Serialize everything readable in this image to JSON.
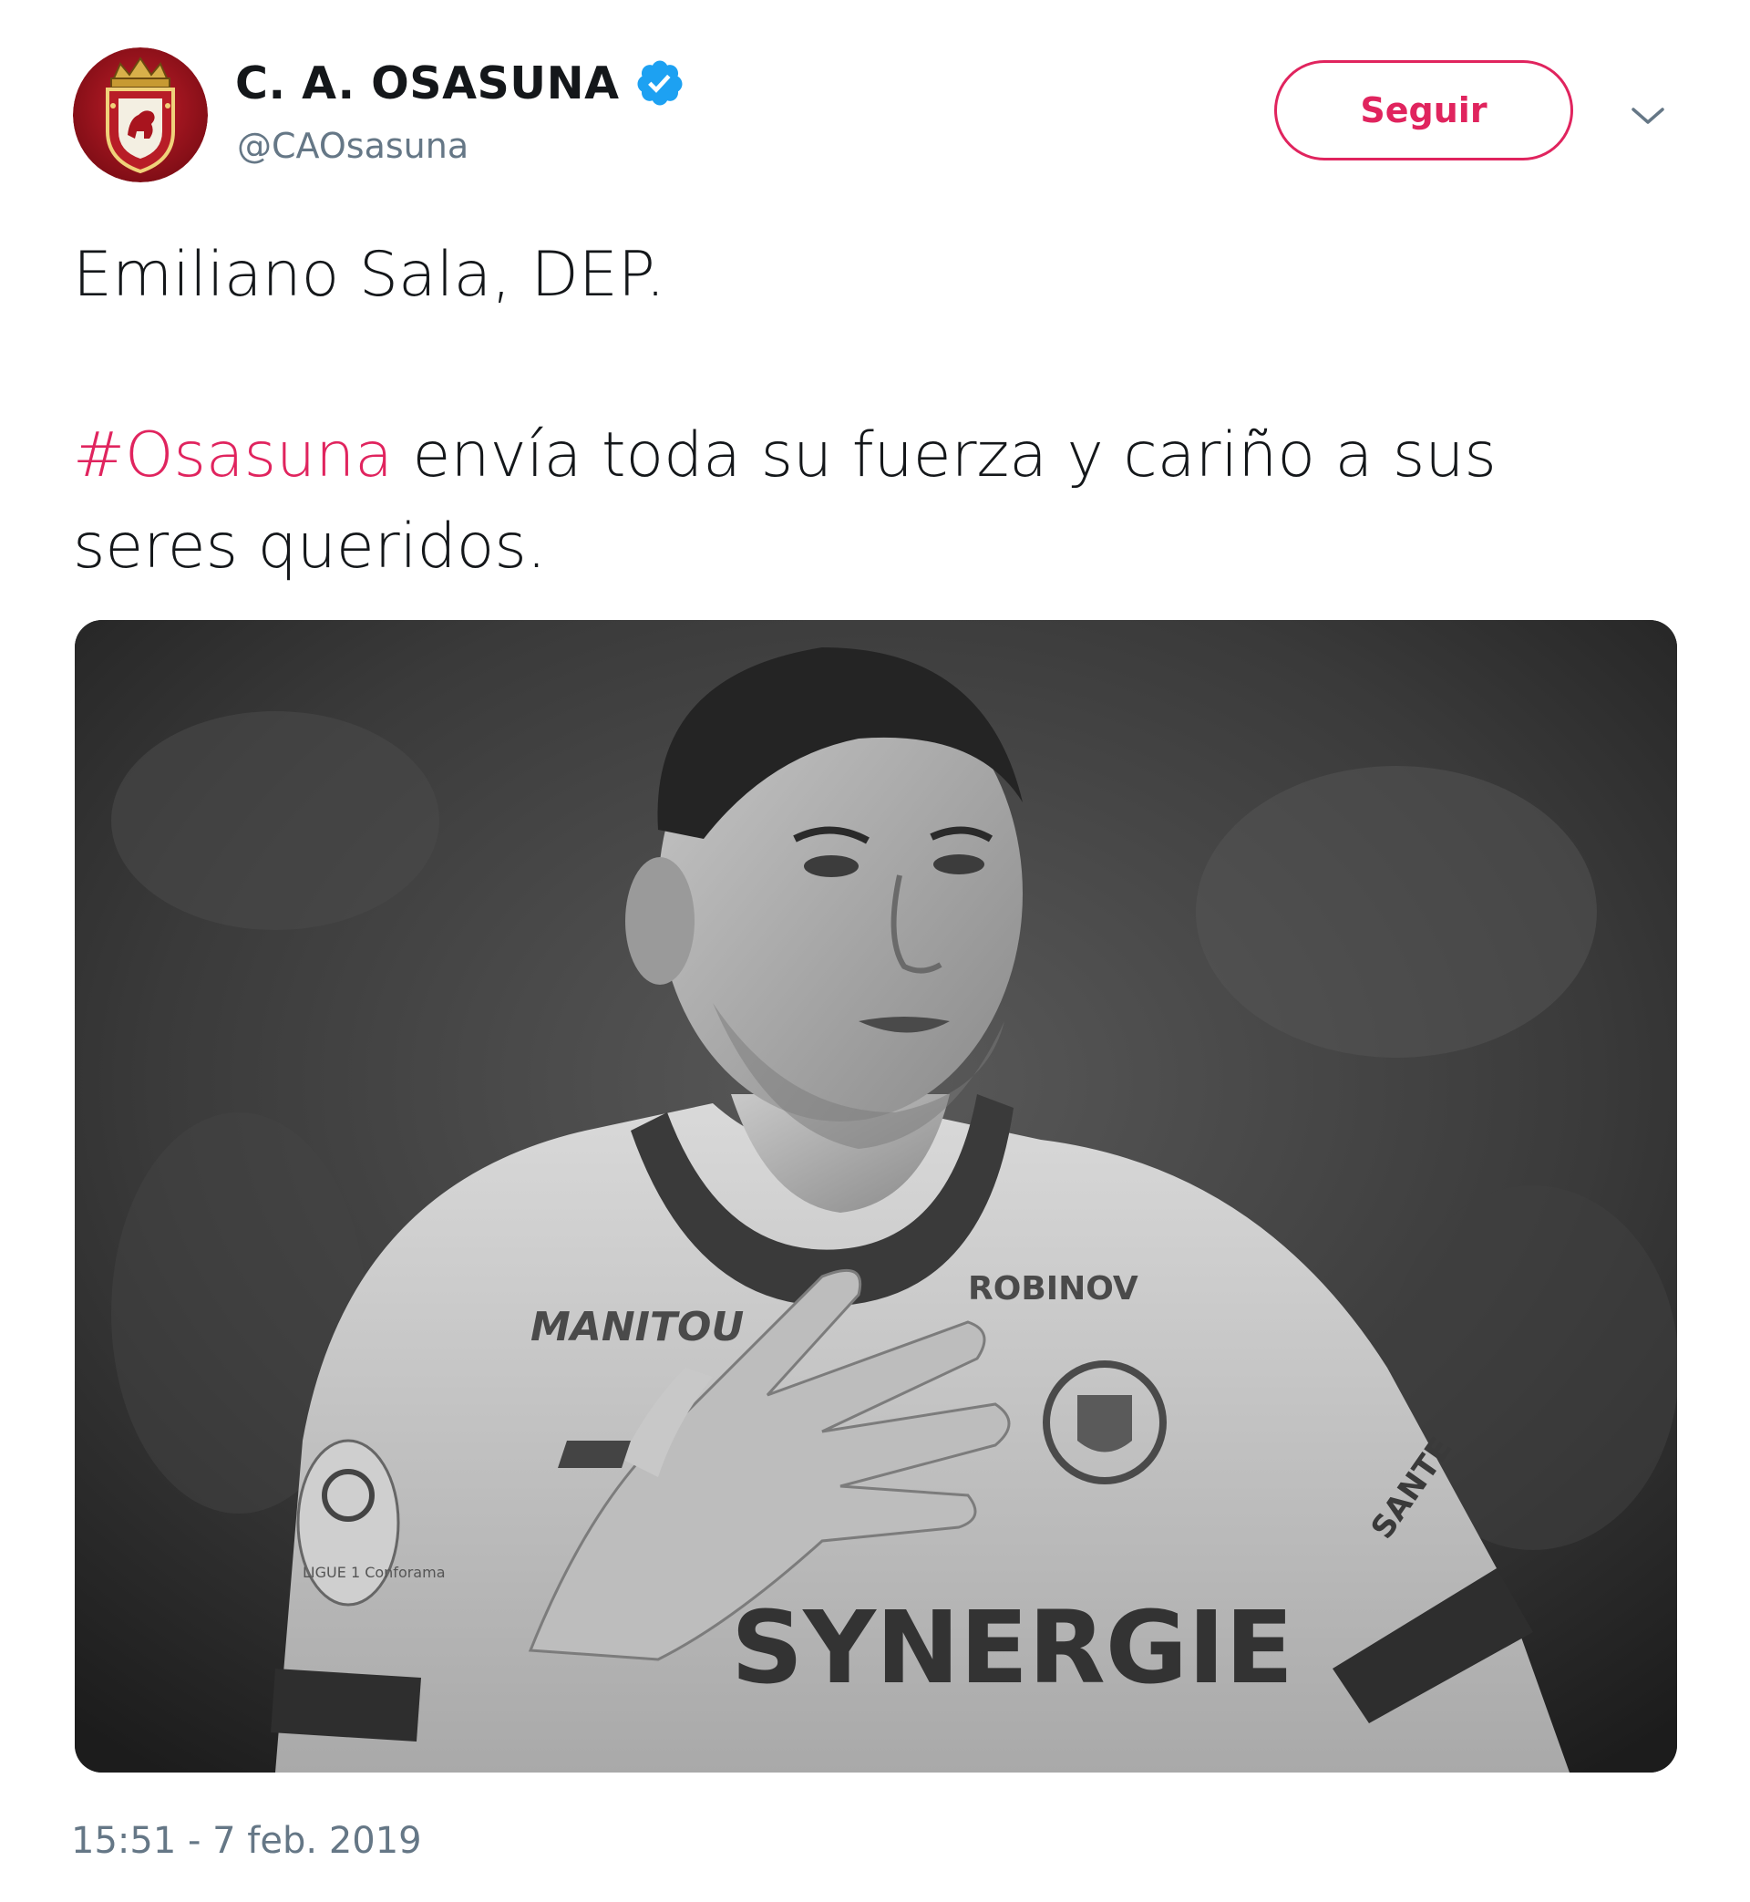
{
  "account": {
    "display_name": "C. A. OSASUNA",
    "handle": "@CAOsasuna",
    "verified": true,
    "avatar_icon": "osasuna-crest-icon"
  },
  "actions": {
    "follow_label": "Seguir",
    "more_icon": "chevron-down-icon"
  },
  "tweet": {
    "line1": "Emiliano Sala, DEP.",
    "hashtag": "#Osasuna",
    "line2_rest": " envía toda su fuerza y cariño a sus seres queridos."
  },
  "media": {
    "jersey_sponsor": "MANITOU",
    "jersey_sponsor2": "SYNERGIE",
    "jersey_top_right": "ROBINOV",
    "sleeve_text": "LIGUE 1 Conforama",
    "armband_text": "SANTE"
  },
  "timestamp": "15:51 - 7 feb. 2019",
  "colors": {
    "accent": "#e0245e",
    "verified_blue": "#1da1f2",
    "secondary_text": "#657786"
  }
}
